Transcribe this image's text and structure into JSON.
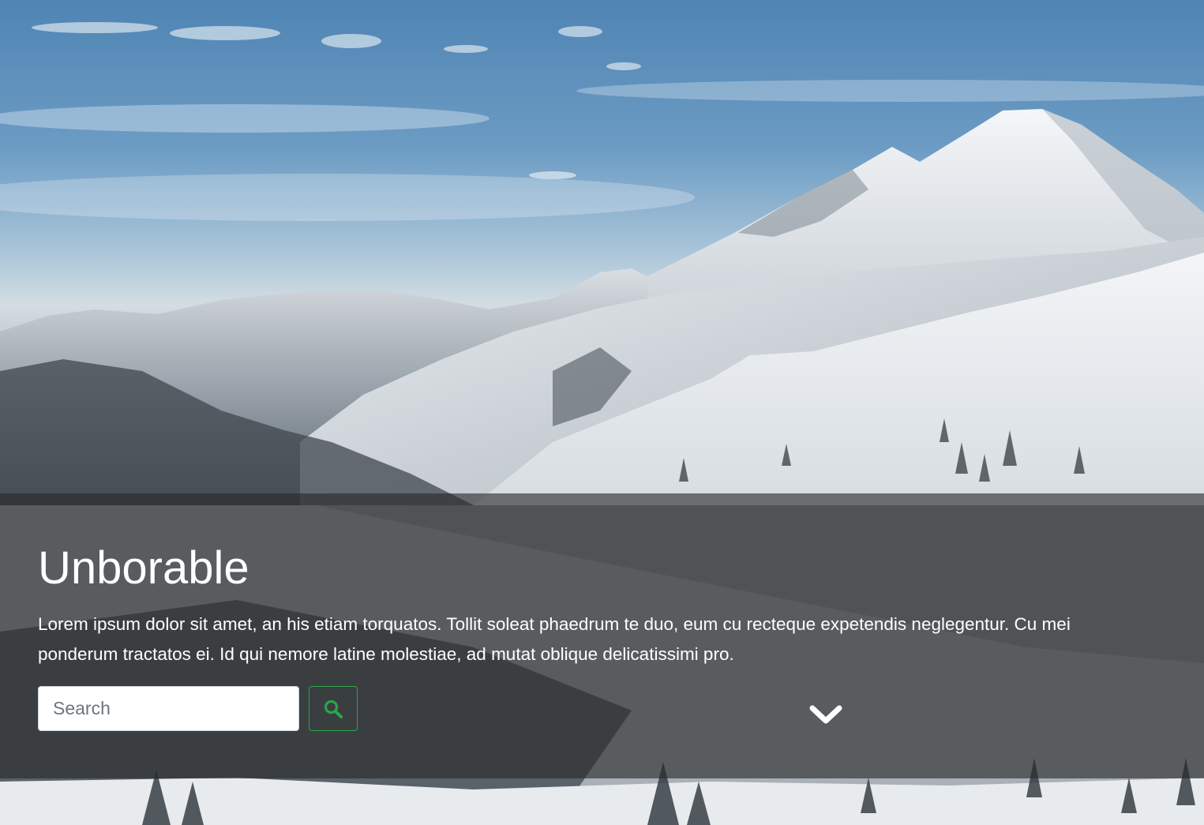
{
  "hero": {
    "title": "Unborable",
    "lead_line_1": "Lorem ipsum dolor sit amet, an his etiam torquatos. Tollit soleat phaedrum te duo, eum cu recteque expetendis neglegentur. Cu mei",
    "lead_line_2": "ponderum tractatos ei. Id qui nemore latine molestiae, ad mutat oblique delicatissimi pro."
  },
  "search": {
    "placeholder": "Search",
    "button_icon": "search-icon"
  },
  "scroll": {
    "icon": "chevron-down-icon"
  },
  "colors": {
    "accent": "#28a745",
    "overlay": "rgba(40,40,40,0.62)",
    "text": "#ffffff"
  }
}
